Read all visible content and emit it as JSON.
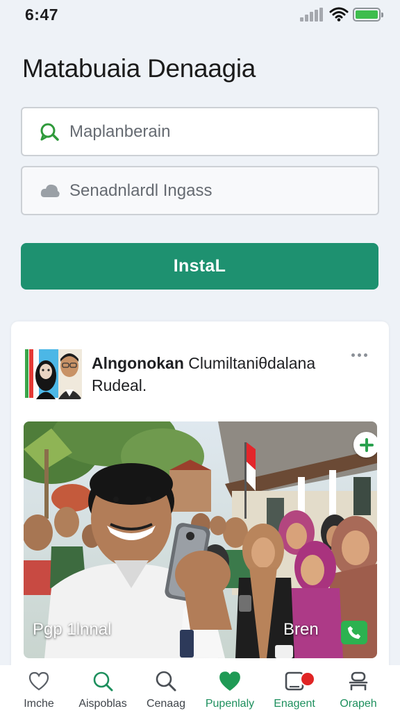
{
  "status_bar": {
    "time": "6:47",
    "battery_color": "#3ebd4d"
  },
  "header": {
    "title": "Matabuaia Denaagia"
  },
  "form": {
    "field1": {
      "placeholder": "Maplanberain",
      "icon": "chat-search-icon"
    },
    "field2": {
      "placeholder": "Senadnlardl Ingass",
      "icon": "cloud-icon"
    },
    "install_label": "InstaL",
    "accent_color": "#1e9170"
  },
  "post": {
    "author": "Alngonokan",
    "text": "Clumiltaniθdalana Rudeal.",
    "caption_left": "Pgp 1lnnal",
    "caption_right": "Bren"
  },
  "bottom_nav": {
    "items": [
      {
        "label": "Imche",
        "icon": "heart-outline-icon"
      },
      {
        "label": "Aispoblas",
        "icon": "search-icon"
      },
      {
        "label": "Cenaag",
        "icon": "search-icon"
      },
      {
        "label": "Pupenlaly",
        "icon": "heart-filled-icon",
        "active": true
      },
      {
        "label": "Enagent",
        "icon": "notification-icon",
        "active": true
      },
      {
        "label": "Orapeh",
        "icon": "profile-icon",
        "active": true
      }
    ]
  }
}
